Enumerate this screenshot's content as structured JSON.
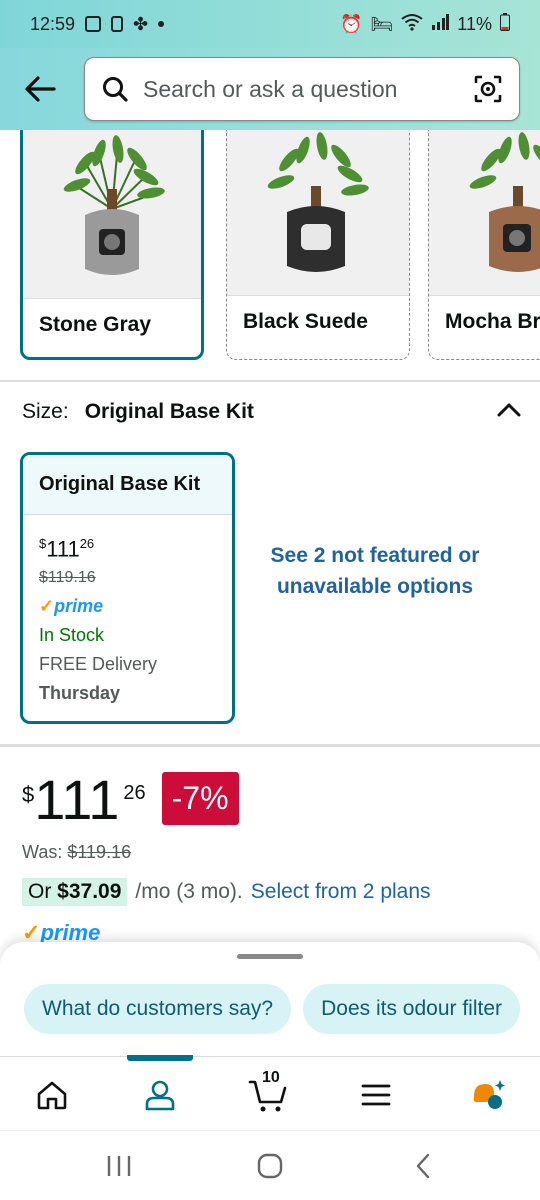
{
  "status_bar": {
    "time": "12:59",
    "battery": "11%"
  },
  "search": {
    "placeholder": "Search or ask a question"
  },
  "colors": {
    "selected": "Stone Gray",
    "options": [
      {
        "label": "Stone Gray"
      },
      {
        "label": "Black Suede"
      },
      {
        "label": "Mocha Br"
      }
    ]
  },
  "size": {
    "label": "Size:",
    "value": "Original Base Kit",
    "card": {
      "title": "Original Base Kit",
      "price_currency": "$",
      "price_whole": "111",
      "price_fraction": "26",
      "was_price": "$119.16",
      "prime": "prime",
      "stock": "In Stock",
      "delivery": "FREE Delivery",
      "delivery_day": "Thursday"
    },
    "unfeatured_link": "See 2 not featured or unavailable options"
  },
  "price": {
    "currency": "$",
    "whole": "111",
    "fraction": "26",
    "discount": "-7%",
    "was_label": "Was:",
    "was_price": "$119.16"
  },
  "plans": {
    "prefix": "Or",
    "monthly": "$37.09",
    "term": "/mo (3 mo).",
    "link": "Select from 2 plans"
  },
  "prime_label": "prime",
  "questions": [
    "What do customers say?",
    "Does its odour filter"
  ],
  "nav": {
    "cart_count": "10",
    "active": "account"
  }
}
